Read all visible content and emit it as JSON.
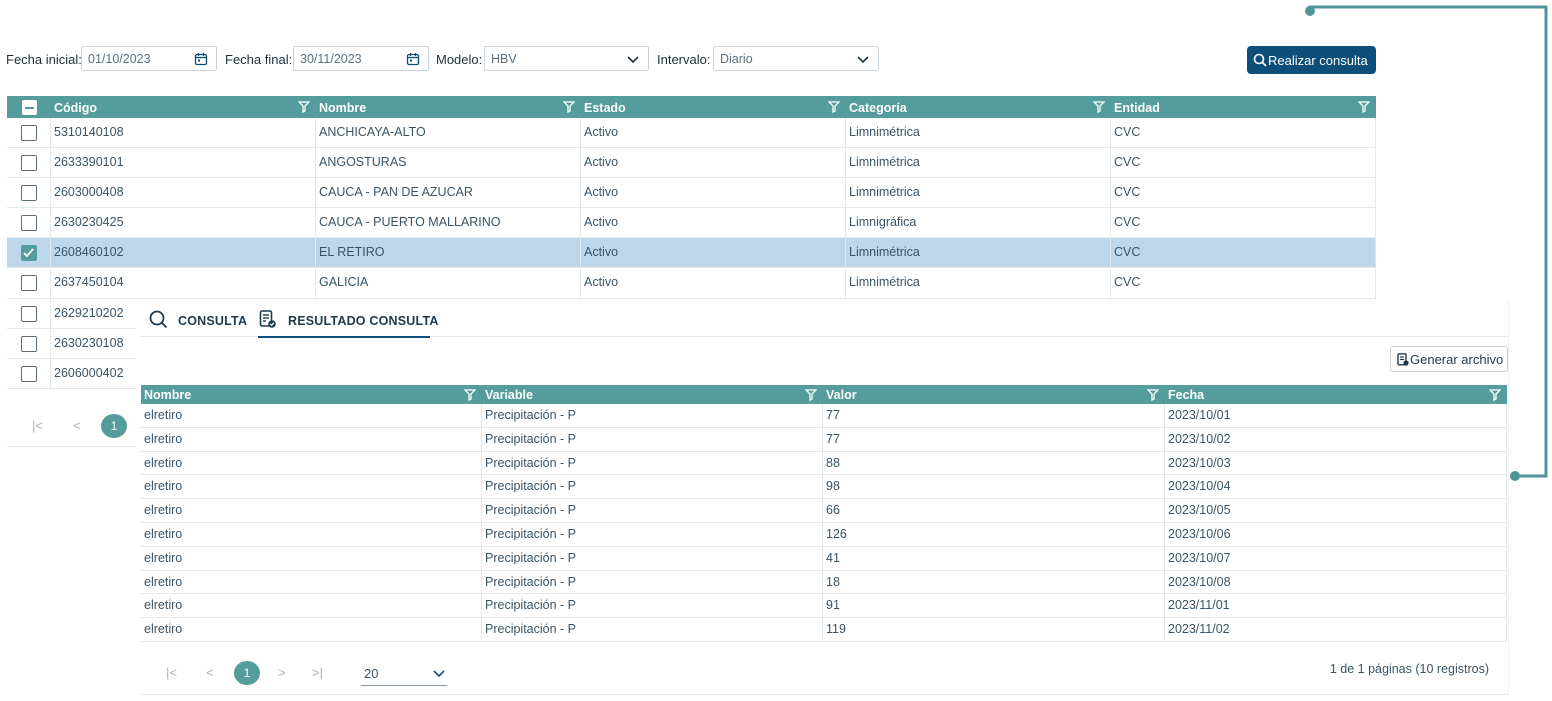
{
  "filters": {
    "fecha_inicial": {
      "label": "Fecha inicial:",
      "value": "01/10/2023"
    },
    "fecha_final": {
      "label": "Fecha final:",
      "value": "30/11/2023"
    },
    "modelo": {
      "label": "Modelo:",
      "value": "HBV"
    },
    "intervalo": {
      "label": "Intervalo:",
      "value": "Diario"
    },
    "submit_label": "Realizar consulta"
  },
  "stations_table": {
    "columns": [
      "Código",
      "Nombre",
      "Estado",
      "Categoría",
      "Entidad"
    ],
    "rows": [
      {
        "codigo": "5310140108",
        "nombre": "ANCHICAYA-ALTO",
        "estado": "Activo",
        "categoria": "Limnimétrica",
        "entidad": "CVC",
        "checked": false
      },
      {
        "codigo": "2633390101",
        "nombre": "ANGOSTURAS",
        "estado": "Activo",
        "categoria": "Limnimétrica",
        "entidad": "CVC",
        "checked": false
      },
      {
        "codigo": "2603000408",
        "nombre": "CAUCA - PAN DE AZUCAR",
        "estado": "Activo",
        "categoria": "Limnimétrica",
        "entidad": "CVC",
        "checked": false
      },
      {
        "codigo": "2630230425",
        "nombre": "CAUCA - PUERTO MALLARINO",
        "estado": "Activo",
        "categoria": "Limnigráfica",
        "entidad": "CVC",
        "checked": false
      },
      {
        "codigo": "2608460102",
        "nombre": "EL RETIRO",
        "estado": "Activo",
        "categoria": "Limnimétrica",
        "entidad": "CVC",
        "checked": true
      },
      {
        "codigo": "2637450104",
        "nombre": "GALICIA",
        "estado": "Activo",
        "categoria": "Limnimétrica",
        "entidad": "CVC",
        "checked": false
      },
      {
        "codigo": "2629210202",
        "checked": false
      },
      {
        "codigo": "2630230108",
        "checked": false
      },
      {
        "codigo": "2606000402",
        "checked": false
      }
    ],
    "current_page": "1"
  },
  "tabs": [
    {
      "label": "CONSULTA",
      "icon": "search-icon",
      "active": false
    },
    {
      "label": "RESULTADO CONSULTA",
      "icon": "document-result-icon",
      "active": true
    }
  ],
  "results": {
    "generate_label": "Generar archivo",
    "columns": [
      "Nombre",
      "Variable",
      "Valor",
      "Fecha"
    ],
    "rows": [
      [
        "elretiro",
        "Precipitación - P",
        "77",
        "2023/10/01"
      ],
      [
        "elretiro",
        "Precipitación - P",
        "77",
        "2023/10/02"
      ],
      [
        "elretiro",
        "Precipitación - P",
        "88",
        "2023/10/03"
      ],
      [
        "elretiro",
        "Precipitación - P",
        "98",
        "2023/10/04"
      ],
      [
        "elretiro",
        "Precipitación - P",
        "66",
        "2023/10/05"
      ],
      [
        "elretiro",
        "Precipitación - P",
        "126",
        "2023/10/06"
      ],
      [
        "elretiro",
        "Precipitación - P",
        "41",
        "2023/10/07"
      ],
      [
        "elretiro",
        "Precipitación - P",
        "18",
        "2023/10/08"
      ],
      [
        "elretiro",
        "Precipitación - P",
        "91",
        "2023/11/01"
      ],
      [
        "elretiro",
        "Precipitación - P",
        "119",
        "2023/11/02"
      ]
    ],
    "current_page": "1",
    "page_size": "20",
    "summary": "1 de 1 páginas (10 registros)"
  },
  "colors": {
    "header": "#559c9c",
    "primary": "#0d4f78",
    "selected_row": "#bdd7ec",
    "connector": "#4f9597"
  }
}
